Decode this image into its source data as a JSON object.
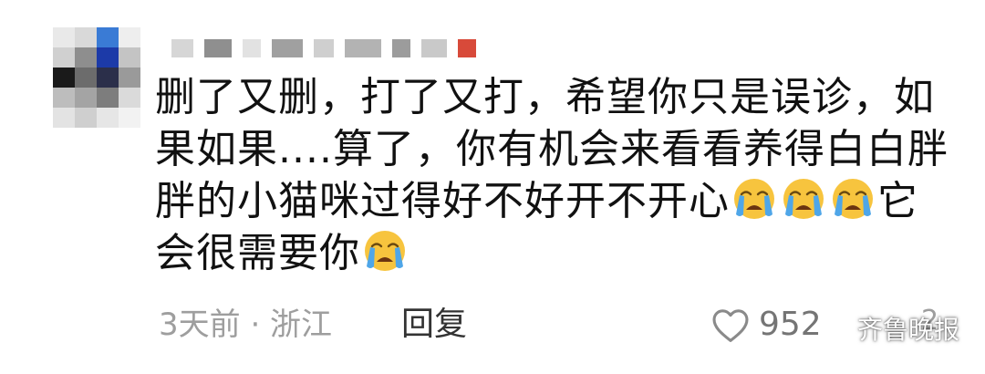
{
  "comment": {
    "segments": [
      {
        "type": "text",
        "value": "删了又删，打了又打，希望你只是误诊，如果如果....算了，你有机会来看看养得白白胖胖的小猫咪过得好不好开不开心"
      },
      {
        "type": "emoji",
        "name": "loudly-crying-face-icon"
      },
      {
        "type": "emoji",
        "name": "loudly-crying-face-icon"
      },
      {
        "type": "emoji",
        "name": "loudly-crying-face-icon"
      },
      {
        "type": "text",
        "value": "它会很需要你"
      },
      {
        "type": "emoji",
        "name": "loudly-crying-face-icon"
      }
    ]
  },
  "footer": {
    "meta": "3天前 · 浙江",
    "reply": "回复",
    "like_count": "952",
    "dislike_partial": "2"
  },
  "watermark": {
    "text": "齐鲁晚报",
    "icon": "wechat-icon"
  },
  "colors": {
    "meta_text": "#9e9e9e",
    "reply_text": "#333333",
    "emoji_face": "#f7c43e",
    "emoji_tears": "#4fa6e8"
  }
}
